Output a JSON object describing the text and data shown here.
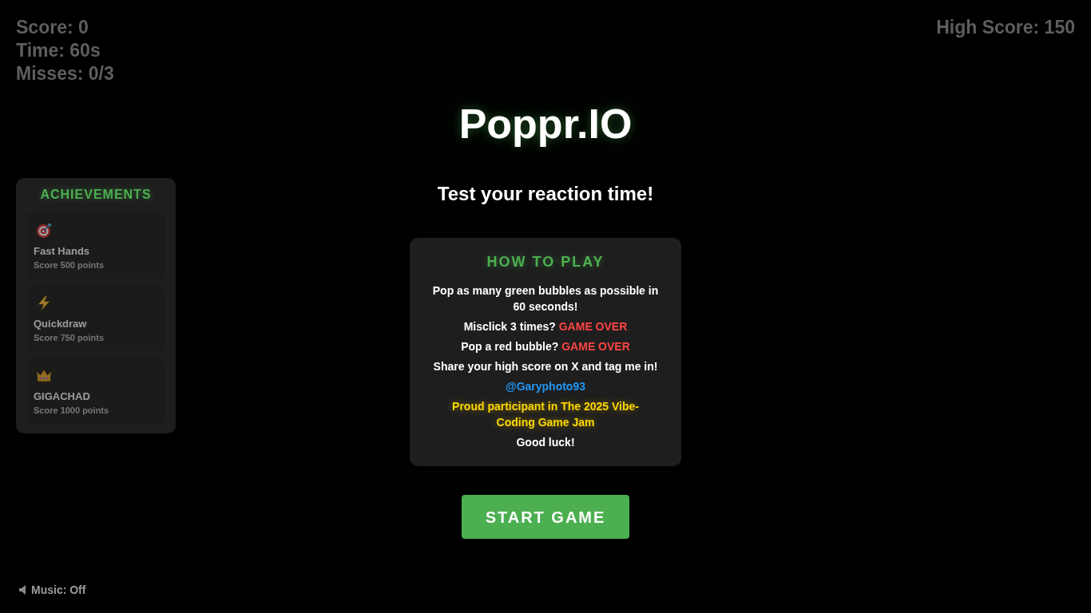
{
  "hud": {
    "score": "Score: 0",
    "time": "Time: 60s",
    "misses": "Misses: 0/3",
    "high_score": "High Score: 150"
  },
  "title": "Poppr.IO",
  "subtitle": "Test your reaction time!",
  "achievements": {
    "title": "ACHIEVEMENTS",
    "items": [
      {
        "name": "Fast Hands",
        "description": "Score 500 points",
        "unlocked": false
      },
      {
        "name": "Quickdraw",
        "description": "Score 750 points",
        "unlocked": false
      },
      {
        "name": "GIGACHAD",
        "description": "Score 1000 points",
        "unlocked": false
      }
    ]
  },
  "how_to_play": {
    "title": "HOW TO PLAY",
    "lines": [
      {
        "kind": "text",
        "text": "Pop as many green bubbles as possible in 60 seconds!"
      },
      {
        "kind": "warning",
        "text": "Misclick 3 times?",
        "alert": "GAME OVER"
      },
      {
        "kind": "warning",
        "text": "Pop a red bubble?",
        "alert": "GAME OVER"
      },
      {
        "kind": "text",
        "text": "Share your high score on X and tag me in!"
      },
      {
        "kind": "link",
        "text": "@Garyphoto93"
      },
      {
        "kind": "highlight",
        "text": "Proud participant in The 2025 Vibe-Coding Game Jam"
      },
      {
        "kind": "text",
        "text": "Good luck!"
      }
    ]
  },
  "start_button": "START GAME",
  "music": "Music: Off"
}
